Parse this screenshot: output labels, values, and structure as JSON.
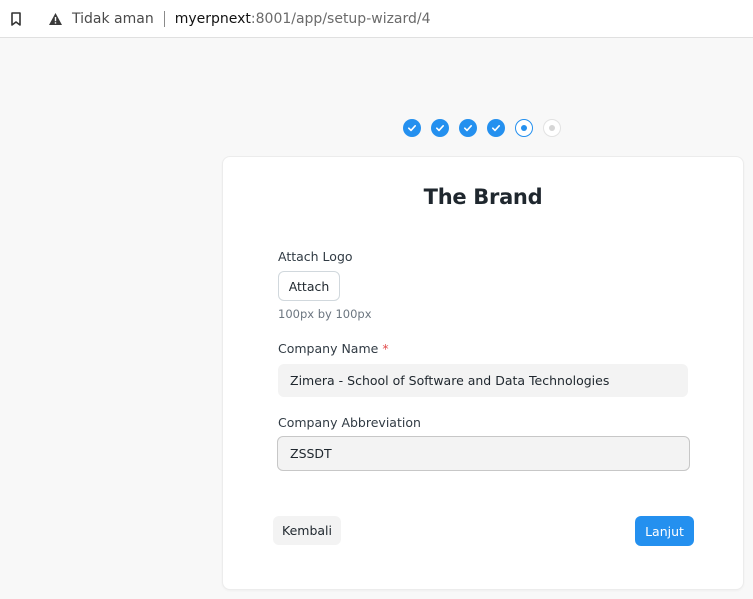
{
  "browser": {
    "security_label": "Tidak aman",
    "url_host": "myerpnext",
    "url_path": ":8001/app/setup-wizard/4"
  },
  "steps": {
    "states": [
      "done",
      "done",
      "done",
      "done",
      "active",
      "pending"
    ],
    "accent_color": "#2490ef"
  },
  "form": {
    "title": "The Brand",
    "logo_label": "Attach Logo",
    "attach_button": "Attach",
    "logo_hint": "100px by 100px",
    "company_name_label": "Company Name",
    "required_marker": "*",
    "company_name_value": "Zimera - School of Software and Data Technologies",
    "abbr_label": "Company Abbreviation",
    "abbr_value": "ZSSDT"
  },
  "actions": {
    "back_label": "Kembali",
    "next_label": "Lanjut"
  }
}
